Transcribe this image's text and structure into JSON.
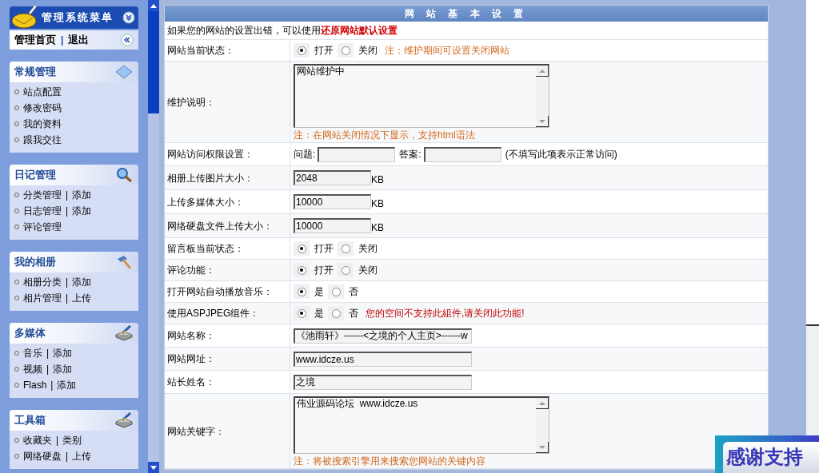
{
  "sidebar": {
    "title": "管理系统菜单",
    "quick_links": [
      "管理首页",
      "退出"
    ],
    "quick_separator": "|",
    "separator": "|",
    "sections": [
      {
        "title": "常规管理",
        "items": [
          {
            "label": "站点配置"
          },
          {
            "label": "修改密码"
          },
          {
            "label": "我的资料"
          },
          {
            "label": "跟我交往"
          }
        ]
      },
      {
        "title": "日记管理",
        "items": [
          {
            "label": "分类管理",
            "extra": "添加"
          },
          {
            "label": "日志管理",
            "extra": "添加"
          },
          {
            "label": "评论管理"
          }
        ]
      },
      {
        "title": "我的相册",
        "items": [
          {
            "label": "相册分类",
            "extra": "添加"
          },
          {
            "label": "相片管理",
            "extra": "上传"
          }
        ]
      },
      {
        "title": "多媒体",
        "items": [
          {
            "label": "音乐",
            "extra": "添加"
          },
          {
            "label": "视频",
            "extra": "添加"
          },
          {
            "label": "Flash",
            "extra": "添加"
          }
        ]
      },
      {
        "title": "工具箱",
        "items": [
          {
            "label": "收藏夹",
            "extra": "类别"
          },
          {
            "label": "网络硬盘",
            "extra": "上传"
          }
        ]
      }
    ]
  },
  "settings": {
    "title": "网 站 基 本 设 置",
    "intro": {
      "text": "如果您的网站的设置出错，可以使用",
      "link": "还原网站默认设置"
    },
    "rows": [
      {
        "kind": "radio",
        "label": "网站当前状态：",
        "options": [
          {
            "label": "打开",
            "selected": true
          },
          {
            "label": "关闭",
            "selected": false
          }
        ],
        "note": {
          "text": "注：维护期间可设置关闭网站",
          "kind": "tip"
        }
      },
      {
        "kind": "textarea",
        "label": "维护说明：",
        "value": "网站维护中",
        "note": {
          "text": "注：在网站关闭情况下显示，支持html语法",
          "kind": "tip"
        }
      },
      {
        "kind": "qa",
        "label": "网站访问权限设置：",
        "question_label": "问题:",
        "answer_label": "答案:",
        "hint": "(不填写此项表示正常访问)"
      },
      {
        "kind": "size",
        "label": "相册上传图片大小：",
        "value": "2048",
        "unit": "KB"
      },
      {
        "kind": "size",
        "label": "上传多媒体大小：",
        "value": "10000",
        "unit": "KB"
      },
      {
        "kind": "size",
        "label": "网络硬盘文件上传大小：",
        "value": "10000",
        "unit": "KB"
      },
      {
        "kind": "radio",
        "label": "留言板当前状态：",
        "options": [
          {
            "label": "打开",
            "selected": true
          },
          {
            "label": "关闭",
            "selected": false
          }
        ]
      },
      {
        "kind": "radio",
        "label": "评论功能：",
        "options": [
          {
            "label": "打开",
            "selected": true
          },
          {
            "label": "关闭",
            "selected": false
          }
        ]
      },
      {
        "kind": "radio",
        "label": "打开网站自动播放音乐：",
        "options": [
          {
            "label": "是",
            "selected": true
          },
          {
            "label": "否",
            "selected": false
          }
        ]
      },
      {
        "kind": "radio",
        "label": "使用ASPJPEG组件：",
        "options": [
          {
            "label": "是",
            "selected": true
          },
          {
            "label": "否",
            "selected": false
          }
        ],
        "note": {
          "text": "您的空间不支持此組件,请关闭此功能!",
          "kind": "warning"
        }
      },
      {
        "kind": "text",
        "label": "网站名称：",
        "value": "《池雨轩》------<之境的个人主页>------w"
      },
      {
        "kind": "text",
        "label": "网站网址：",
        "value": "www.idcze.us"
      },
      {
        "kind": "text",
        "label": "站长姓名：",
        "value": "之境"
      },
      {
        "kind": "textarea",
        "label": "网站关键字：",
        "value": "伟业源码论坛  www.idcze.us",
        "note": {
          "text": "注：将被搜索引擎用来搜索您网站的关键内容",
          "kind": "tip"
        }
      }
    ]
  },
  "badge": "感谢支持"
}
